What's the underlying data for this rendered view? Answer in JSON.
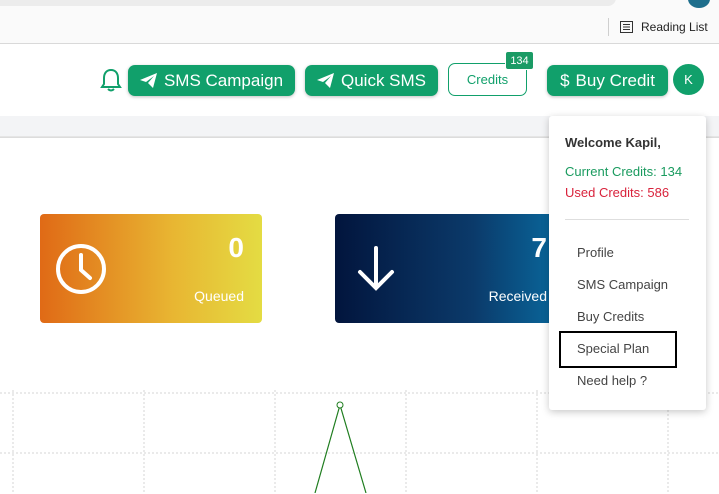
{
  "browser": {
    "reading_list": "Reading List"
  },
  "header": {
    "sms_campaign": "SMS Campaign",
    "quick_sms": "Quick SMS",
    "credits": "Credits",
    "credits_badge": "134",
    "buy_credit": "Buy Credit",
    "avatar_initial": "K"
  },
  "stats": {
    "queued": {
      "value": "0",
      "label": "Queued"
    },
    "received": {
      "value": "7",
      "label": "Received"
    }
  },
  "dropdown": {
    "welcome": "Welcome Kapil,",
    "current_credits": "Current Credits: 134",
    "used_credits": "Used Credits: 586",
    "items": [
      "Profile",
      "SMS Campaign",
      "Buy Credits",
      "Special Plan",
      "Need help ?"
    ]
  },
  "colors": {
    "accent": "#11a06b",
    "used": "#d9233c"
  }
}
